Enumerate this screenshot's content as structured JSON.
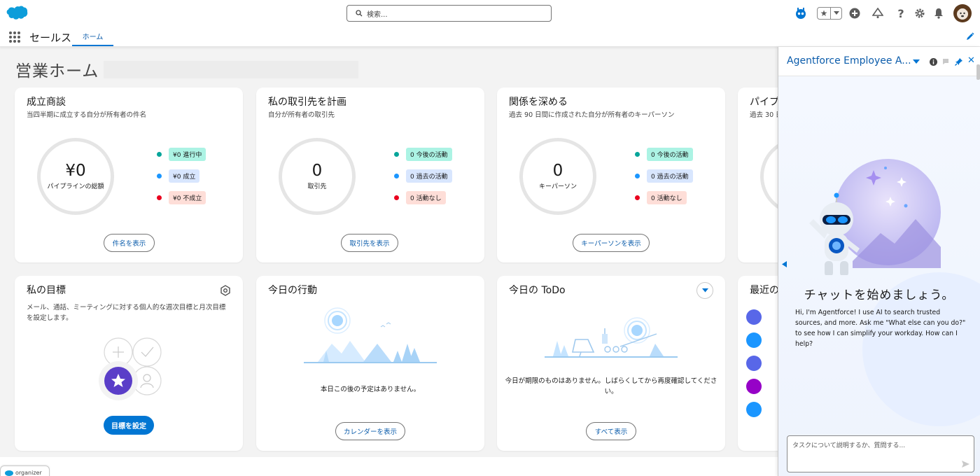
{
  "header": {
    "search_placeholder": "検索...",
    "icons": [
      "agentforce-icon",
      "favorites-icon",
      "add-icon",
      "trailhead-icon",
      "help-icon",
      "setup-icon",
      "notifications-icon",
      "avatar"
    ]
  },
  "nav": {
    "app_name": "セールス",
    "tabs": [
      {
        "label": "ホーム",
        "active": true
      }
    ]
  },
  "page": {
    "title": "営業ホーム"
  },
  "cards": {
    "closed_deals": {
      "title": "成立商談",
      "subtitle": "当四半期に成立する自分が所有者の件名",
      "ring_value": "¥0",
      "ring_label": "パイプラインの総額",
      "legend": [
        {
          "label": "¥0 進行中",
          "dot": "#06a59a",
          "bg": "#acf3e4"
        },
        {
          "label": "¥0 成立",
          "dot": "#1b96ff",
          "bg": "#d8e6fe"
        },
        {
          "label": "¥0 不成立",
          "dot": "#ea001e",
          "bg": "#feded8"
        }
      ],
      "button": "件名を表示"
    },
    "plan_accounts": {
      "title": "私の取引先を計画",
      "subtitle": "自分が所有者の取引先",
      "ring_value": "0",
      "ring_label": "取引先",
      "legend": [
        {
          "label": "0 今後の活動",
          "dot": "#06a59a",
          "bg": "#acf3e4"
        },
        {
          "label": "0 過去の活動",
          "dot": "#1b96ff",
          "bg": "#d8e6fe"
        },
        {
          "label": "0 活動なし",
          "dot": "#ea001e",
          "bg": "#feded8"
        }
      ],
      "button": "取引先を表示"
    },
    "deepen": {
      "title": "関係を深める",
      "subtitle": "過去 90 日間に作成された自分が所有者のキーパーソン",
      "ring_value": "0",
      "ring_label": "キーパーソン",
      "legend": [
        {
          "label": "0 今後の活動",
          "dot": "#06a59a",
          "bg": "#acf3e4"
        },
        {
          "label": "0 過去の活動",
          "dot": "#1b96ff",
          "bg": "#d8e6fe"
        },
        {
          "label": "0 活動なし",
          "dot": "#ea001e",
          "bg": "#feded8"
        }
      ],
      "button": "キーパーソンを表示"
    },
    "pipeline": {
      "title": "パイプ",
      "subtitle": "過去 30 日"
    },
    "goals": {
      "title": "私の目標",
      "subtitle_line1": "メール、通話、ミーティングに対する個人的な週次目標と月次目標",
      "subtitle_line2": "を設定します。",
      "button": "目標を設定"
    },
    "today_events": {
      "title": "今日の行動",
      "empty": "本日この後の予定はありません。",
      "button": "カレンダーを表示"
    },
    "today_todo": {
      "title": "今日の ToDo",
      "empty_line1": "今日が期限のものはありません。しばらくしてから再度確認してくださ",
      "empty_line2": "い。",
      "button": "すべて表示"
    },
    "recent": {
      "title": "最近の",
      "items": [
        {
          "icon": "account-icon",
          "color": "#5867e8"
        },
        {
          "icon": "contact-icon",
          "color": "#1b96ff"
        },
        {
          "icon": "account-icon",
          "color": "#5867e8"
        },
        {
          "icon": "lead-icon",
          "color": "#9602c7"
        },
        {
          "icon": "contact-icon",
          "color": "#1b96ff"
        }
      ]
    }
  },
  "agent_panel": {
    "title": "Agentforce Employee A...",
    "heading": "チャットを始めましょう。",
    "intro": "Hi, I'm Agentforce! I use AI to search trusted sources, and more. Ask me \"What else can you do?\" to see how I can simplify your workday. How can I help?",
    "input_placeholder": "タスクについて説明するか、質問する..."
  },
  "utility_bar": {
    "organizer_label": "organizer"
  },
  "colors": {
    "brand": "#0176d3",
    "link": "#0b5cab"
  }
}
